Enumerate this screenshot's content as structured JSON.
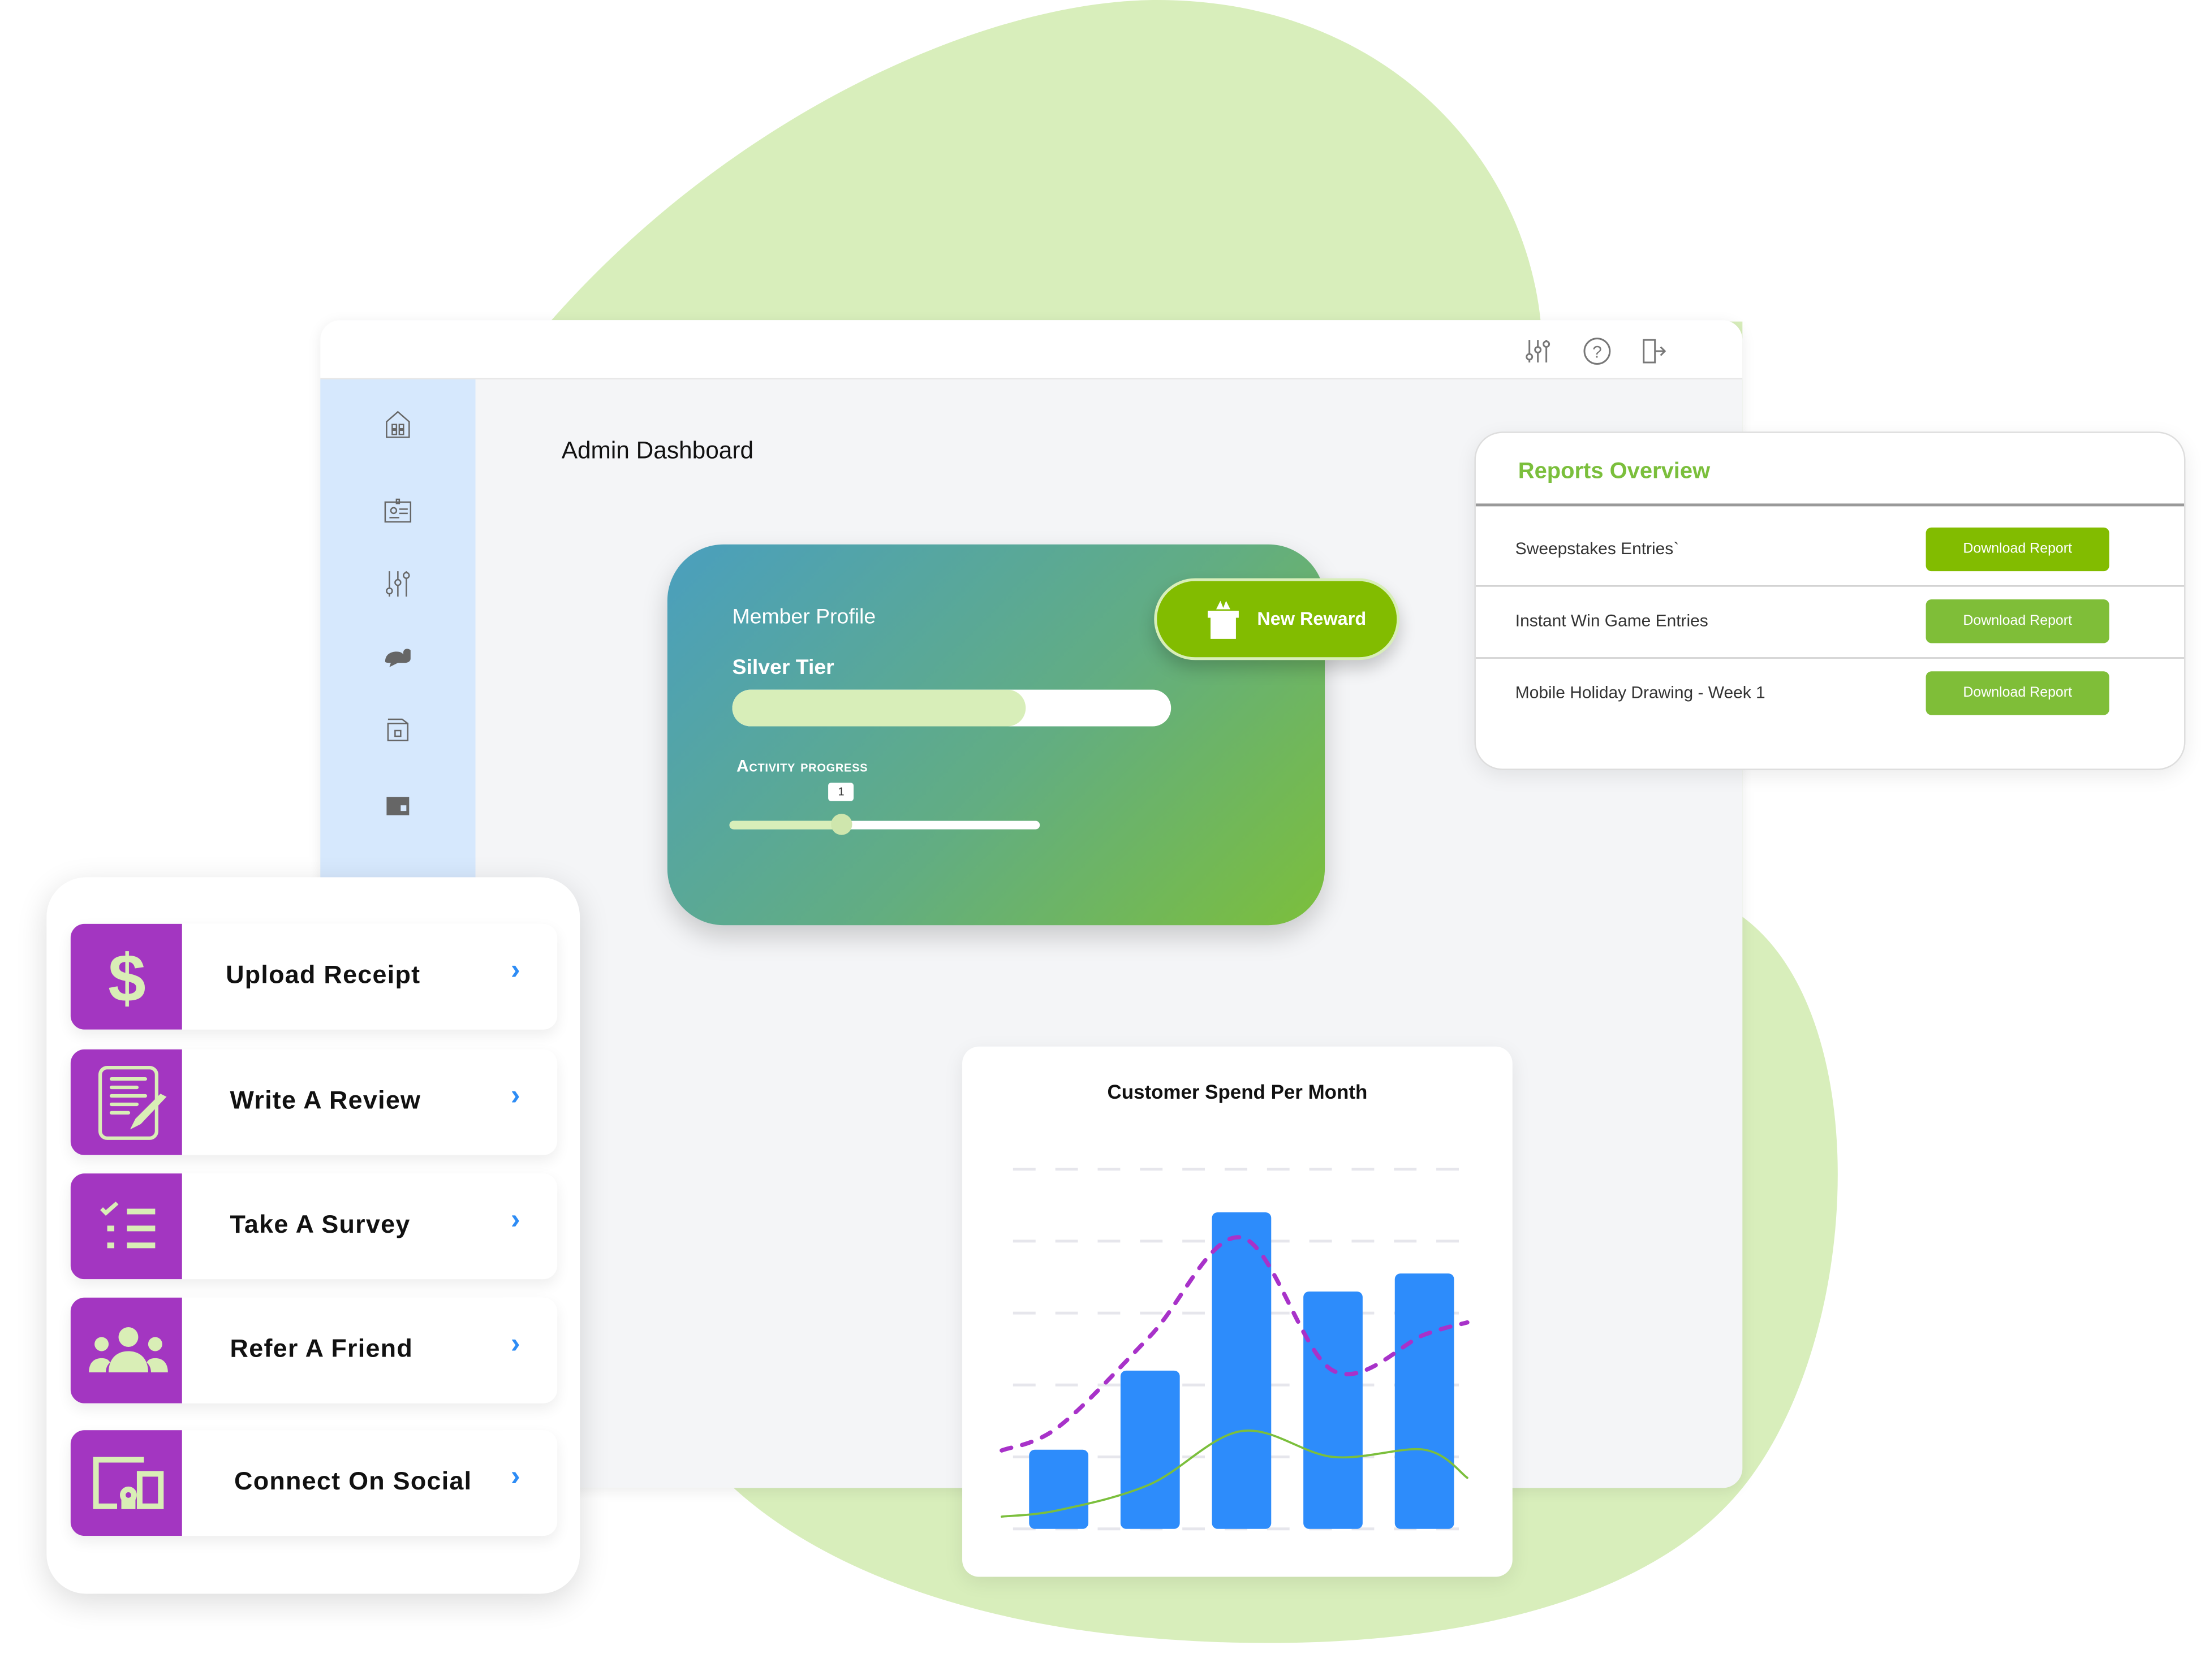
{
  "colors": {
    "blob": "#d8eebb",
    "accent_green": "#82bc00",
    "purple": "#a336c1",
    "bar_blue": "#2d8cfb",
    "sidebar": "#d6e8fd"
  },
  "header": {
    "icons": [
      "sliders-icon",
      "help-icon",
      "logout-icon"
    ]
  },
  "sidebar": {
    "icons": [
      "home-icon",
      "id-card-icon",
      "sliders-icon",
      "chat-icon",
      "archive-icon",
      "wallet-icon"
    ]
  },
  "page": {
    "title": "Admin Dashboard"
  },
  "member": {
    "label": "Member Profile",
    "tier": "Silver Tier",
    "tier_progress_pct": 67,
    "activity_label": "Activity progress",
    "activity_value": "1",
    "activity_pct": 36,
    "reward_button": "New Reward"
  },
  "reports": {
    "title": "Reports Overview",
    "rows": [
      {
        "label": "Sweepstakes Entries`",
        "button": "Download Report"
      },
      {
        "label": "Instant Win Game Entries",
        "button": "Download Report"
      },
      {
        "label": "Mobile Holiday Drawing - Week 1",
        "button": "Download Report"
      }
    ]
  },
  "chart_data": {
    "type": "bar",
    "title": "Customer Spend Per Month",
    "ylim": [
      0,
      5
    ],
    "grid": true,
    "values": [
      1.1,
      2.2,
      4.4,
      3.3,
      3.55
    ],
    "series": [
      {
        "type": "line",
        "style": "dashed",
        "color": "#a832c9",
        "values": [
          1.09,
          1.42,
          2.68,
          4.05,
          2.2,
          2.7,
          2.87
        ]
      },
      {
        "type": "line",
        "style": "solid",
        "color": "#7bbf3c",
        "values": [
          0.17,
          0.26,
          0.62,
          1.36,
          1.0,
          1.1,
          0.71
        ]
      }
    ]
  },
  "tasks": [
    {
      "label": "Upload Receipt",
      "icon": "dollar-icon"
    },
    {
      "label": "Write A Review",
      "icon": "review-icon"
    },
    {
      "label": "Take A Survey",
      "icon": "checklist-icon"
    },
    {
      "label": "Refer A Friend",
      "icon": "group-icon"
    },
    {
      "label": "Connect On Social",
      "icon": "devices-icon"
    }
  ]
}
